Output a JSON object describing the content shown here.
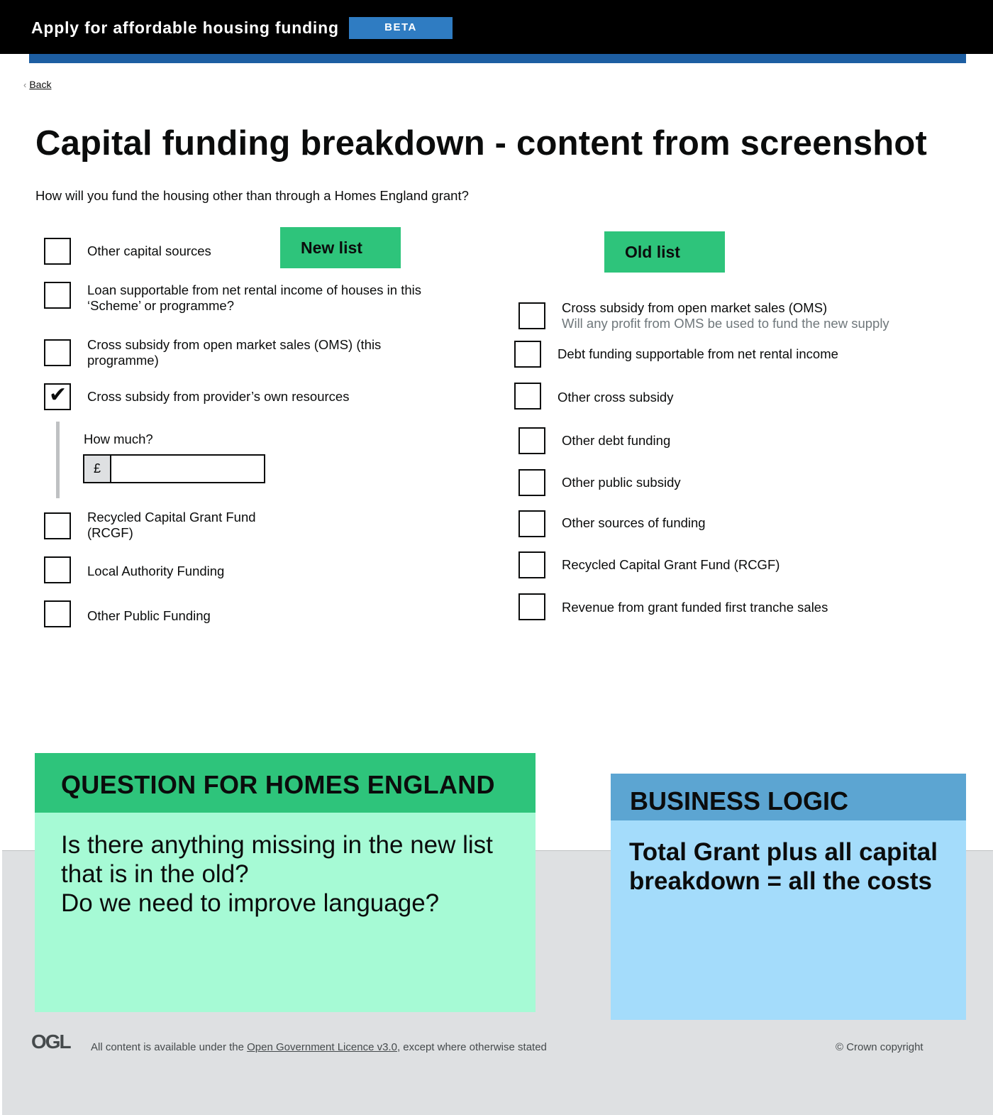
{
  "header": {
    "service_name": "Apply for affordable housing funding",
    "phase_tag": "BETA"
  },
  "nav": {
    "back_label": "Back"
  },
  "page": {
    "title": "Capital funding breakdown - content from screenshot",
    "question": "How will you fund the housing other than through a Homes England grant?"
  },
  "new_list": {
    "tag": "New list",
    "items": [
      {
        "label": "Other capital sources",
        "checked": false
      },
      {
        "label": "Loan supportable from net rental income of houses in this",
        "label2": "‘Scheme’ or programme?",
        "checked": false
      },
      {
        "label": "Cross subsidy from open market sales (OMS) (this",
        "label2": "programme)",
        "checked": false
      },
      {
        "label": "Cross subsidy from provider’s own resources",
        "checked": true
      },
      {
        "label": "Recycled Capital Grant Fund",
        "label2": "(RCGF)",
        "checked": false
      },
      {
        "label": "Local Authority Funding",
        "checked": false
      },
      {
        "label": "Other Public Funding",
        "checked": false
      }
    ],
    "conditional": {
      "label": "How much?",
      "prefix": "£",
      "value": ""
    }
  },
  "old_list": {
    "tag": "Old list",
    "items": [
      {
        "label": "Cross subsidy from open market sales (OMS)",
        "hint": "Will any profit from OMS be used to fund the new supply",
        "checked": false
      },
      {
        "label": "Debt funding supportable from net rental income",
        "checked": false
      },
      {
        "label": "Other cross subsidy",
        "checked": false
      },
      {
        "label": "Other debt funding",
        "checked": false
      },
      {
        "label": "Other public subsidy",
        "checked": false
      },
      {
        "label": "Other sources of funding",
        "checked": false
      },
      {
        "label": "Recycled Capital Grant Fund (RCGF)",
        "checked": false
      },
      {
        "label": "Revenue from grant funded first tranche sales",
        "checked": false
      }
    ]
  },
  "notes": {
    "question": {
      "heading": "QUESTION FOR HOMES ENGLAND",
      "lines": [
        "Is there anything missing in the new list",
        "that is in the old?",
        "Do we need to improve language?"
      ]
    },
    "logic": {
      "heading": "BUSINESS LOGIC",
      "lines": [
        "Total Grant plus all capital",
        "breakdown = all the costs"
      ]
    }
  },
  "footer": {
    "logo": "OGL",
    "licence_prefix": "All content is available under the ",
    "licence_link": "Open Government Licence v3.0",
    "licence_suffix": ", except where otherwise stated",
    "copyright": "© Crown copyright"
  },
  "colors": {
    "header_bg": "#000000",
    "beta_tag": "#2f7cc2",
    "header_bar": "#1d5ea2",
    "sticky_green": "#2ec47b",
    "note_green_body": "#a6fad5",
    "note_blue_head": "#5ca5d2",
    "note_blue_body": "#a4dcfb",
    "footer_bg": "#dee0e2"
  }
}
